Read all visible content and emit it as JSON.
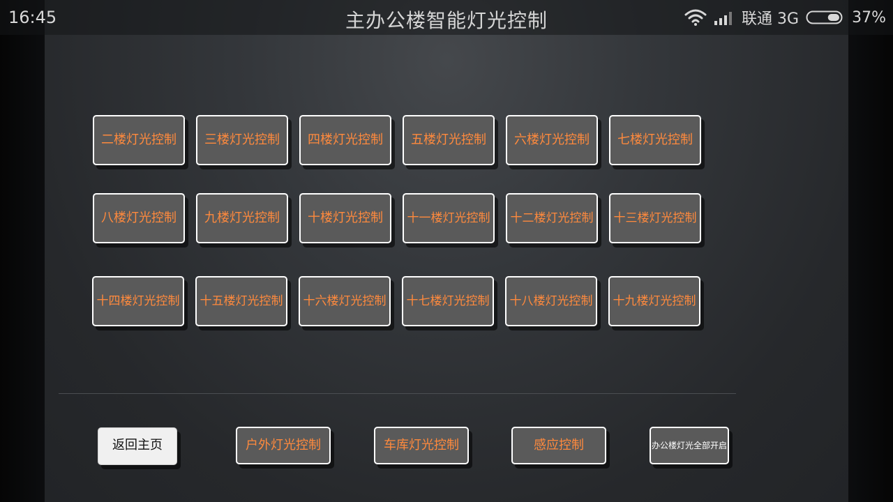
{
  "status_bar": {
    "time": "16:45",
    "carrier": "联通 3G",
    "battery": "37%",
    "battery_level": 0.37
  },
  "header": {
    "title": "主办公楼智能灯光控制"
  },
  "floor_buttons": [
    [
      "二楼灯光控制",
      "三楼灯光控制",
      "四楼灯光控制",
      "五楼灯光控制",
      "六楼灯光控制",
      "七楼灯光控制"
    ],
    [
      "八楼灯光控制",
      "九楼灯光控制",
      "十楼灯光控制",
      "十一楼灯光控制",
      "十二楼灯光控制",
      "十三楼灯光控制"
    ],
    [
      "十四楼灯光控制",
      "十五楼灯光控制",
      "十六楼灯光控制",
      "十七楼灯光控制",
      "十八楼灯光控制",
      "十九楼灯光控制"
    ]
  ],
  "bottom_bar": {
    "home": "返回主页",
    "outdoor": "户外灯光控制",
    "garage": "车库灯光控制",
    "sensor": "感应控制",
    "all_on": "办公楼灯光全部开启"
  },
  "colors": {
    "button_text": "#ff8a3d",
    "button_fill": "#5a5a5a",
    "button_border": "#ffffff"
  },
  "icons": [
    "wifi-icon",
    "signal-icon",
    "battery-icon"
  ]
}
